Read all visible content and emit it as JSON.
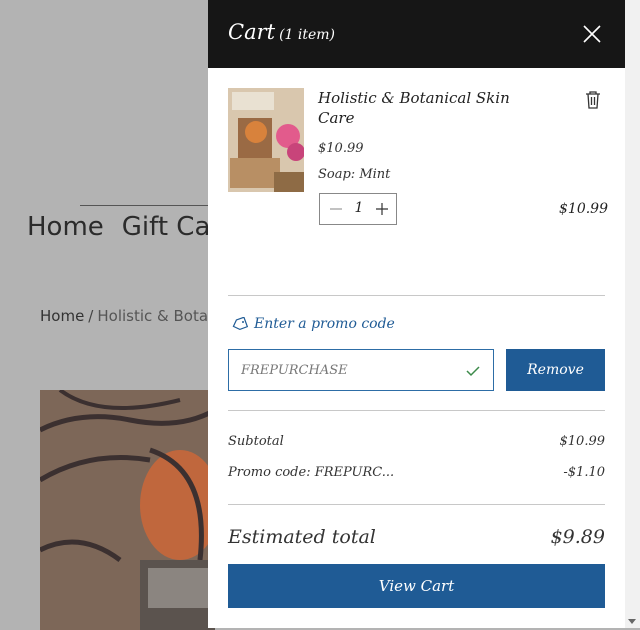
{
  "background": {
    "nav_items": [
      "Home",
      "Gift Ca"
    ],
    "breadcrumb_home": "Home",
    "breadcrumb_sep": "/",
    "breadcrumb_current": "Holistic & Botan"
  },
  "cart": {
    "title": "Cart",
    "count_label": "(1 item)",
    "item": {
      "name": "Holistic & Botanical Skin Care",
      "price": "$10.99",
      "option": "Soap: Mint",
      "quantity": "1",
      "line_total": "$10.99"
    },
    "promo": {
      "link_label": "Enter a promo code",
      "code_value": "FREPURCHASE",
      "remove_label": "Remove"
    },
    "summary": {
      "subtotal_label": "Subtotal",
      "subtotal_value": "$10.99",
      "promo_label": "Promo code: FREPURC...",
      "promo_value": "-$1.10"
    },
    "estimated_total_label": "Estimated total",
    "estimated_total_value": "$9.89",
    "view_cart_label": "View Cart"
  },
  "colors": {
    "header_bg": "#161616",
    "accent": "#1f5b95",
    "overlay": "#b3b3b3"
  }
}
